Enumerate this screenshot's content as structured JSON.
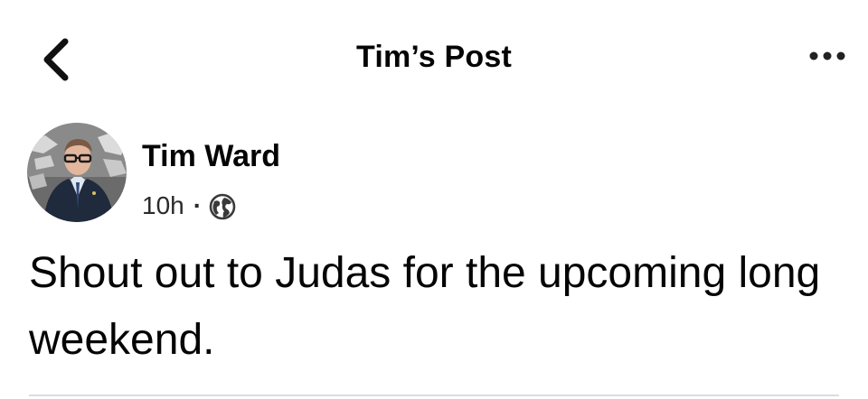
{
  "header": {
    "title": "Tim’s Post",
    "back_icon": "chevron-left-icon",
    "more_icon": "more-horizontal-icon"
  },
  "post": {
    "author": {
      "name": "Tim Ward",
      "avatar_icon": "profile-photo"
    },
    "meta": {
      "time": "10h",
      "separator": "·",
      "privacy_icon": "globe-icon"
    },
    "text": "Shout out to Judas for the upcoming long weekend."
  },
  "colors": {
    "text": "#050505",
    "secondary_text": "#2a2a2a",
    "divider": "#dadde1",
    "background": "#ffffff"
  }
}
